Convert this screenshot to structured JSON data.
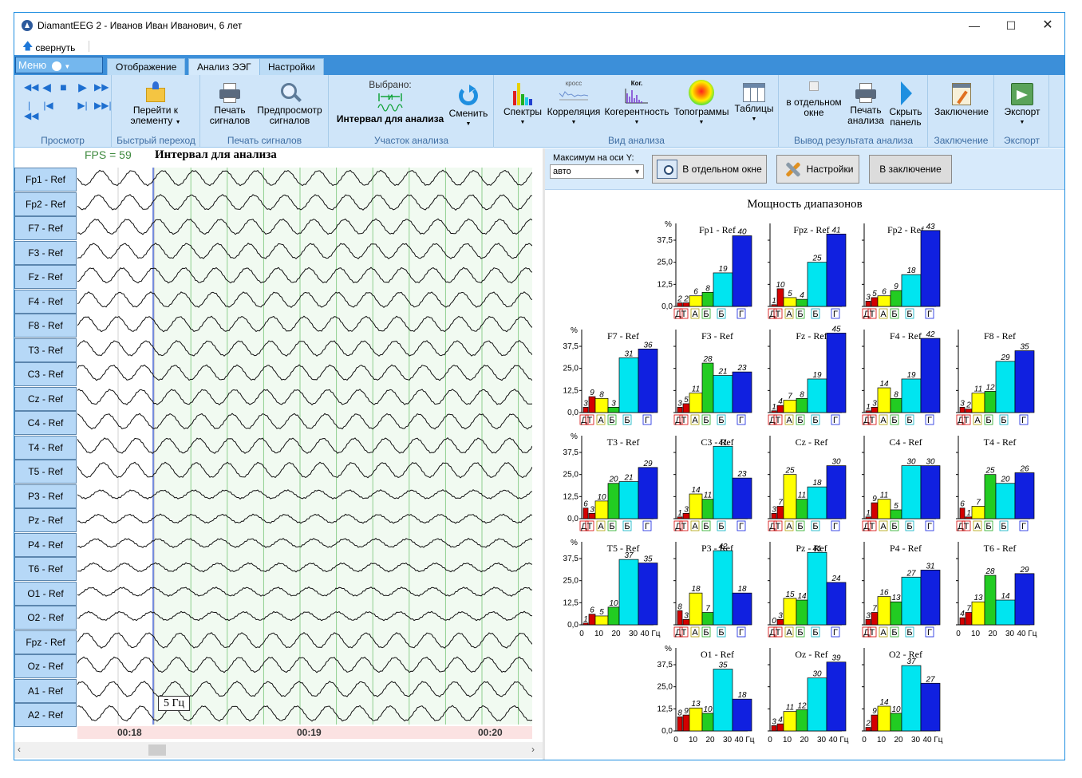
{
  "window": {
    "title": "DiamantEEG 2 - Иванов  Иван Иванович, 6 лет",
    "collapse_label": "свернуть",
    "menu_label": "Меню"
  },
  "tabs": [
    "Отображение",
    "Анализ ЭЭГ",
    "Настройки"
  ],
  "ribbon": {
    "groups": {
      "view": "Просмотр",
      "jump": "Быстрый переход",
      "print": "Печать сигналов",
      "segment": "Участок анализа",
      "analysis": "Вид анализа",
      "output": "Вывод результата анализа",
      "conclusion": "Заключение",
      "export": "Экспорт"
    },
    "goto_label_1": "Перейти к",
    "goto_label_2": "элементу",
    "print_label_1": "Печать",
    "print_label_2": "сигналов",
    "preview_label_1": "Предпросмотр",
    "preview_label_2": "сигналов",
    "selected_label": "Выбрано:",
    "selected_value": "Интервал для анализа",
    "change_label": "Сменить",
    "spectra_label": "Спектры",
    "correlation_label": "Корреляция",
    "correlation_icon_text": "кросс",
    "coherence_label": "Когерентность",
    "coherence_icon_text": "Ког.",
    "topograms_label": "Топограммы",
    "tables_label": "Таблицы",
    "separate_window_1": "в отдельном",
    "separate_window_2": "окне",
    "print_analysis_1": "Печать",
    "print_analysis_2": "анализа",
    "hide_panel_1": "Скрыть",
    "hide_panel_2": "панель",
    "conclusion_label": "Заключение",
    "export_label": "Экспорт"
  },
  "eeg": {
    "fps": "FPS = 59",
    "interval_title": "Интервал для анализа",
    "frequency_marker": "5 Гц",
    "channels": [
      "Fp1 - Ref",
      "Fp2 - Ref",
      "F7 - Ref",
      "F3 - Ref",
      "Fz - Ref",
      "F4 - Ref",
      "F8 - Ref",
      "T3 - Ref",
      "C3 - Ref",
      "Cz - Ref",
      "C4 - Ref",
      "T4 - Ref",
      "T5 - Ref",
      "P3 - Ref",
      "Pz - Ref",
      "P4 - Ref",
      "T6 - Ref",
      "O1 - Ref",
      "O2 - Ref",
      "Fpz - Ref",
      "Oz - Ref",
      "A1 - Ref",
      "A2 - Ref"
    ],
    "time_labels": [
      "00:18",
      "00:19",
      "00:20"
    ]
  },
  "panel": {
    "ymax_label": "Максимум на оси Y:",
    "ymax_value": "авто",
    "separate_window_button": "В отдельном окне",
    "settings_button": "Настройки",
    "to_conclusion_button": "В заключение",
    "charts_title": "Мощность диапазонов"
  },
  "chart_data": {
    "type": "bar",
    "categories": [
      "Д",
      "Т",
      "А",
      "Б",
      "Б",
      "Г"
    ],
    "colors": [
      "#d40000",
      "#ffff00",
      "#22cc22",
      "#00e5f0",
      "#1020e0"
    ],
    "unit_y": "%",
    "yticks": [
      "0,0",
      "12,5",
      "25,0",
      "37,5"
    ],
    "x_ticks": [
      "0",
      "10",
      "20",
      "30",
      "40 Гц"
    ],
    "ylim": [
      0,
      47
    ],
    "charts": [
      {
        "name": "Fp1 - Ref",
        "values": [
          2,
          2,
          6,
          8,
          19,
          40
        ]
      },
      {
        "name": "Fpz - Ref",
        "values": [
          1,
          10,
          5,
          4,
          25,
          41
        ]
      },
      {
        "name": "Fp2 - Ref",
        "values": [
          3,
          5,
          6,
          9,
          18,
          43
        ]
      },
      {
        "name": "F7 - Ref",
        "values": [
          3,
          9,
          8,
          3,
          31,
          36
        ]
      },
      {
        "name": "F3 - Ref",
        "values": [
          3,
          5,
          11,
          28,
          21,
          23
        ]
      },
      {
        "name": "Fz - Ref",
        "values": [
          1,
          4,
          7,
          8,
          19,
          45
        ]
      },
      {
        "name": "F4 - Ref",
        "values": [
          1,
          3,
          14,
          8,
          19,
          42
        ]
      },
      {
        "name": "F8 - Ref",
        "values": [
          3,
          2,
          11,
          12,
          29,
          35
        ]
      },
      {
        "name": "T3 - Ref",
        "values": [
          6,
          3,
          10,
          20,
          21,
          29
        ]
      },
      {
        "name": "C3 - Ref",
        "values": [
          1,
          3,
          14,
          11,
          41,
          23
        ]
      },
      {
        "name": "Cz - Ref",
        "values": [
          3,
          7,
          25,
          11,
          18,
          30
        ]
      },
      {
        "name": "C4 - Ref",
        "values": [
          1,
          9,
          11,
          5,
          30,
          30
        ]
      },
      {
        "name": "T4 - Ref",
        "values": [
          6,
          1,
          7,
          25,
          20,
          26
        ]
      },
      {
        "name": "T5 - Ref",
        "values": [
          1,
          6,
          5,
          10,
          37,
          35
        ]
      },
      {
        "name": "P3 - Ref",
        "values": [
          8,
          3,
          18,
          7,
          42,
          18
        ]
      },
      {
        "name": "Pz - Ref",
        "values": [
          0,
          3,
          15,
          14,
          41,
          24
        ]
      },
      {
        "name": "P4 - Ref",
        "values": [
          3,
          7,
          16,
          13,
          27,
          31
        ]
      },
      {
        "name": "T6 - Ref",
        "values": [
          4,
          7,
          13,
          28,
          14,
          29
        ]
      },
      {
        "name": "O1 - Ref",
        "values": [
          8,
          9,
          13,
          10,
          35,
          18
        ]
      },
      {
        "name": "Oz - Ref",
        "values": [
          3,
          4,
          11,
          12,
          30,
          39
        ]
      },
      {
        "name": "O2 - Ref",
        "values": [
          2,
          9,
          14,
          10,
          37,
          27
        ]
      }
    ]
  }
}
